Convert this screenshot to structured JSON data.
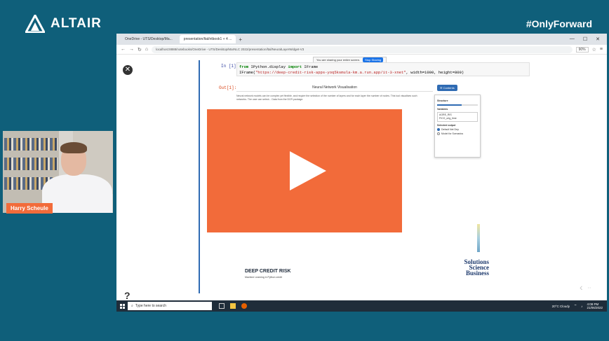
{
  "brand": {
    "name": "ALTAIR",
    "tagline": "#OnlyForward"
  },
  "presenter": {
    "name": "Harry Scheule"
  },
  "browser": {
    "tabs": [
      {
        "label": "OneDrive - UTS/Desktop/Ma..."
      },
      {
        "label": "presentation/ltal/ntbook1 + 4 ..."
      }
    ],
    "url": "localhost:8888/notebooks/OneDrive - UTS/Desktop/MarNLC 2022/presentation/ltal/NeuralLayerWidget-V3",
    "zoom": "90%",
    "share_notice": "You are sharing your entire screen.",
    "share_stop": "Stop Sharing"
  },
  "notebook": {
    "in_prompt": "In [1]:",
    "out_prompt": "Out[1]:",
    "code_line1_kw1": "from",
    "code_line1_mod": " IPython.display ",
    "code_line1_kw2": "import",
    "code_line1_name": " IFrame",
    "code_line2_start": "IFrame(",
    "code_line2_str": "\"https://deep-credit-risk-apps-yoq5ksmula-km.a.run.app/it-3-xnet\"",
    "code_line2_end": ", width=1000, height=800)",
    "app_title": "Neural Network Visualisation",
    "app_desc": "Neural network models can be complex yet flexible, and require the selection of the number of layers and for each layer the number of nodes. This tool visualises such networks. The user can select... Data from the DCR package.",
    "contents_label": "Contents",
    "panel": {
      "structure_label": "Structure",
      "variables_label": "Variables",
      "variables": [
        "AGRE_RIS",
        "FICO_orig_time"
      ],
      "output_label": "Selected output",
      "options": [
        "Default Net Dep",
        "Model for Scenarios"
      ]
    },
    "credit_title": "DEEP CREDIT RISK",
    "credit_sub": "Machine Learning in Python credit",
    "logo_line1": "Solutions",
    "logo_line2": "Science",
    "logo_line3": "Business"
  },
  "taskbar": {
    "search_placeholder": "Type here to search",
    "weather": "20°C Cloudy",
    "time": "4:08 PM",
    "date": "21/06/2022"
  },
  "colors": {
    "accent": "#f26b3a",
    "background": "#0f5f7a",
    "notebook_blue": "#2f6bb3"
  }
}
